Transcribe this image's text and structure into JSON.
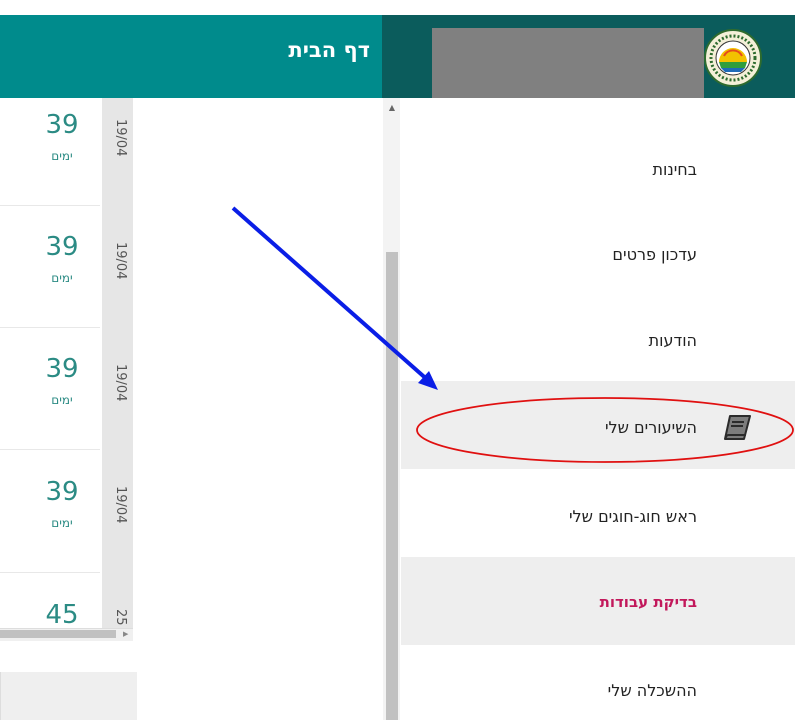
{
  "header": {
    "title": "דף הבית"
  },
  "schedule": [
    {
      "count": "39",
      "unit": "ימים",
      "date": "19/04"
    },
    {
      "count": "39",
      "unit": "ימים",
      "date": "19/04"
    },
    {
      "count": "39",
      "unit": "ימים",
      "date": "19/04"
    },
    {
      "count": "39",
      "unit": "ימים",
      "date": "19/04"
    },
    {
      "count": "45",
      "unit": "",
      "date": "25"
    }
  ],
  "menu": {
    "items": [
      {
        "label": "בחינות"
      },
      {
        "label": "עדכון פרטים"
      },
      {
        "label": "הודעות"
      },
      {
        "label": "השיעורים שלי",
        "icon": "book-icon"
      },
      {
        "label": "ראש חוג-חוגים שלי"
      },
      {
        "label": "בדיקת עבודות"
      },
      {
        "label": "ההשכלה שלי"
      }
    ]
  },
  "colors": {
    "header_teal": "#008b8c",
    "header_dark": "#0b5c5c",
    "accent_text": "#2b8b84",
    "highlight_label": "#c2185b",
    "annotation_arrow": "#0a1ee6",
    "annotation_circle": "#e01010"
  }
}
